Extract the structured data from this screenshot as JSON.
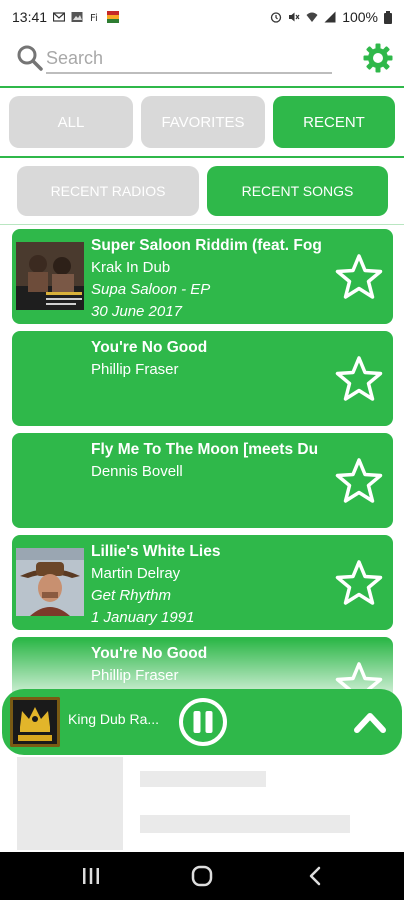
{
  "status_bar": {
    "time": "13:41",
    "battery": "100%",
    "left_icons": [
      "gmail-icon",
      "image-icon",
      "font-icon",
      "app-icon"
    ],
    "right_icons": [
      "alarm-icon",
      "mute-icon",
      "wifi-icon",
      "signal-icon",
      "battery-icon"
    ]
  },
  "search": {
    "placeholder": "Search"
  },
  "tabs": [
    {
      "label": "ALL",
      "active": false
    },
    {
      "label": "FAVORITES",
      "active": false
    },
    {
      "label": "RECENT",
      "active": true
    }
  ],
  "subtabs": [
    {
      "label": "RECENT RADIOS",
      "active": false
    },
    {
      "label": "RECENT SONGS",
      "active": true
    }
  ],
  "songs": [
    {
      "title": "Super Saloon Riddim (feat. Fog",
      "artist": "Krak In Dub",
      "album": "Supa Saloon - EP",
      "date": "30 June 2017",
      "has_art": true
    },
    {
      "title": "You're No Good",
      "artist": "Phillip Fraser",
      "album": "",
      "date": "",
      "has_art": false
    },
    {
      "title": "Fly Me To The Moon [meets Du",
      "artist": "Dennis Bovell",
      "album": "",
      "date": "",
      "has_art": false
    },
    {
      "title": "Lillie's White Lies",
      "artist": "Martin Delray",
      "album": "Get Rhythm",
      "date": "1 January 1991",
      "has_art": true
    },
    {
      "title": "You're No Good",
      "artist": "Phillip Fraser",
      "album": "",
      "date": "",
      "has_art": false
    }
  ],
  "player": {
    "station_name": "King Dub Ra...",
    "state": "playing"
  },
  "colors": {
    "accent": "#2fb84a",
    "inactive_tab": "#d9d9d9",
    "text_light": "#ffffff"
  }
}
